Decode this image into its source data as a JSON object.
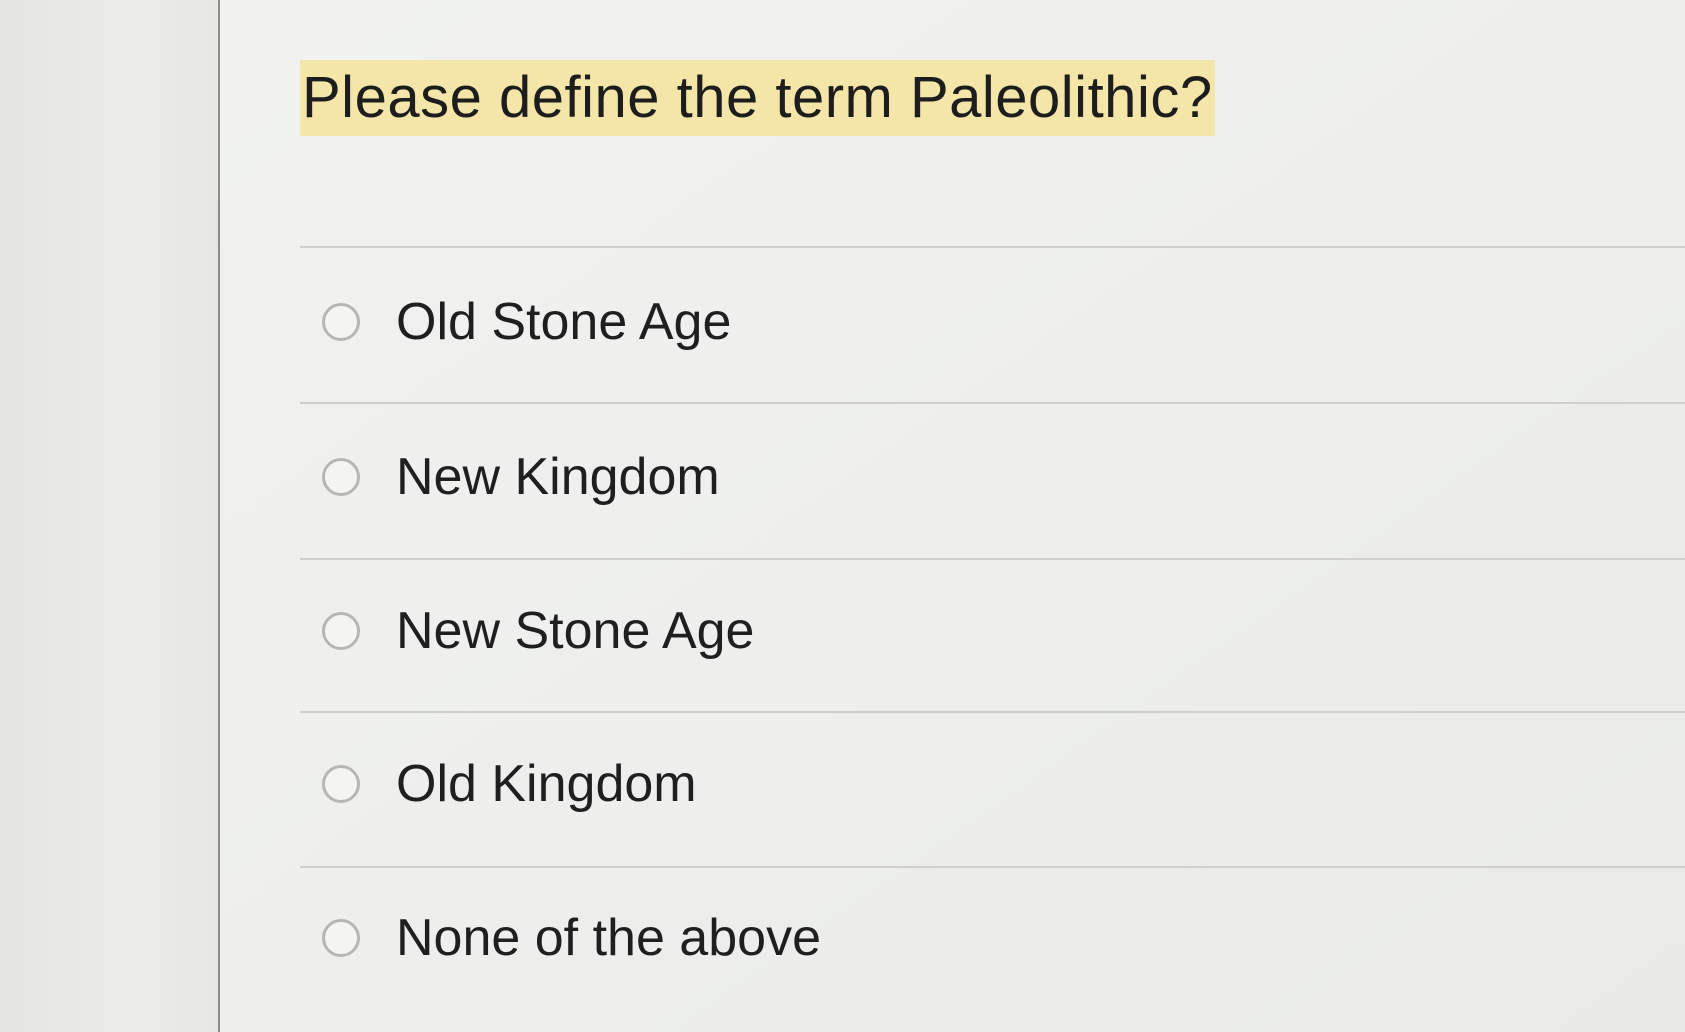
{
  "question": {
    "text": "Please define the term Paleolithic?"
  },
  "options": [
    {
      "label": "Old Stone Age",
      "selected": false
    },
    {
      "label": "New Kingdom",
      "selected": false
    },
    {
      "label": "New Stone Age",
      "selected": false
    },
    {
      "label": "Old Kingdom",
      "selected": false
    },
    {
      "label": "None of the above",
      "selected": false
    }
  ],
  "colors": {
    "highlight": "#f3e6a8",
    "background": "#eeefed",
    "text": "#1f1f1f"
  }
}
